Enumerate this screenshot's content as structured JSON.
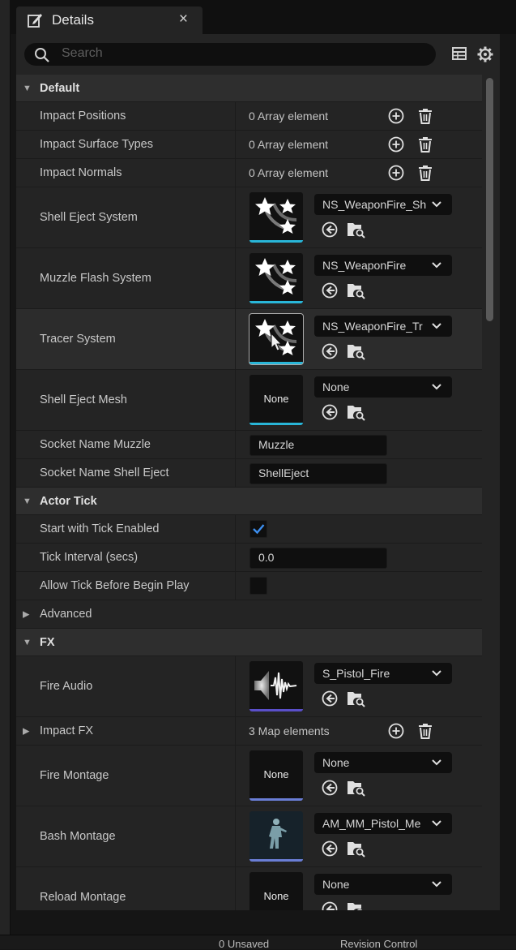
{
  "tab": {
    "title": "Details",
    "close": "×"
  },
  "search": {
    "placeholder": "Search"
  },
  "toolbar": {
    "table_icon": "table-view-icon",
    "settings_icon": "gear-icon"
  },
  "sections": {
    "default": "Default",
    "actor_tick": "Actor Tick",
    "advanced": "Advanced",
    "fx": "FX"
  },
  "rows": {
    "impact_positions": {
      "label": "Impact Positions",
      "value": "0 Array element"
    },
    "impact_surface_types": {
      "label": "Impact Surface Types",
      "value": "0 Array element"
    },
    "impact_normals": {
      "label": "Impact Normals",
      "value": "0 Array element"
    },
    "shell_eject_system": {
      "label": "Shell Eject System",
      "asset": "NS_WeaponFire_Sh"
    },
    "muzzle_flash_system": {
      "label": "Muzzle Flash System",
      "asset": "NS_WeaponFire"
    },
    "tracer_system": {
      "label": "Tracer System",
      "asset": "NS_WeaponFire_Tr"
    },
    "shell_eject_mesh": {
      "label": "Shell Eject Mesh",
      "asset": "None",
      "thumb": "None"
    },
    "socket_name_muzzle": {
      "label": "Socket Name Muzzle",
      "value": "Muzzle"
    },
    "socket_name_shell_eject": {
      "label": "Socket Name Shell Eject",
      "value": "ShellEject"
    },
    "start_with_tick_enabled": {
      "label": "Start with Tick Enabled",
      "checked": true
    },
    "tick_interval": {
      "label": "Tick Interval (secs)",
      "value": "0.0"
    },
    "allow_tick_before_begin_play": {
      "label": "Allow Tick Before Begin Play",
      "checked": false
    },
    "fire_audio": {
      "label": "Fire Audio",
      "asset": "S_Pistol_Fire"
    },
    "impact_fx": {
      "label": "Impact FX",
      "value": "3 Map elements"
    },
    "fire_montage": {
      "label": "Fire Montage",
      "asset": "None",
      "thumb": "None"
    },
    "bash_montage": {
      "label": "Bash Montage",
      "asset": "AM_MM_Pistol_Me"
    },
    "reload_montage": {
      "label": "Reload Montage",
      "asset": "None",
      "thumb": "None"
    }
  },
  "colors": {
    "accent_niagara": "#29b6d8",
    "accent_sound": "#5a4fc9",
    "accent_anim": "#6a7ed6",
    "checkbox_tick": "#3d8ff0"
  },
  "bottom_bar": {
    "item1": "0 Unsaved",
    "item2": "Revision Control"
  }
}
